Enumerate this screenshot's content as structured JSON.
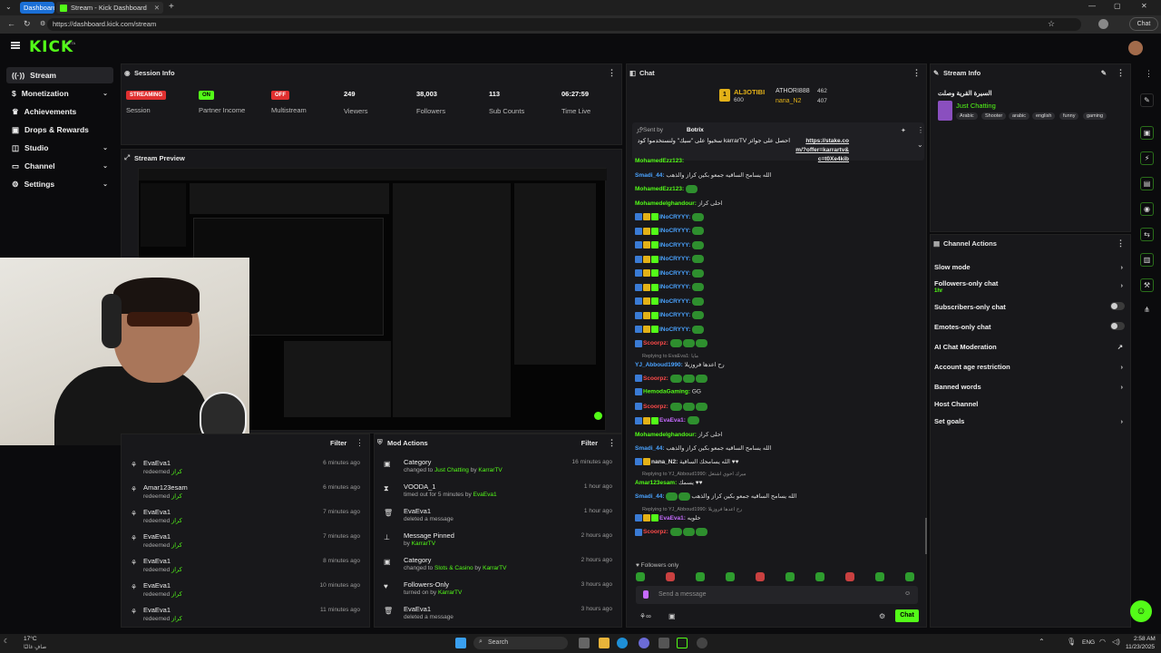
{
  "browser": {
    "tabs": [
      {
        "label": "Dashboard",
        "active": false
      },
      {
        "label": "Stream - Kick Dashboard",
        "active": true
      }
    ],
    "url": "https://dashboard.kick.com/stream",
    "chat_label": "Chat"
  },
  "brand": {
    "logo": "KICK",
    "beta": "BETA",
    "accent": "#53fc18"
  },
  "sidebar": {
    "items": [
      {
        "label": "Stream",
        "icon": "broadcast-icon",
        "active": true,
        "expandable": false
      },
      {
        "label": "Monetization",
        "icon": "dollar-icon",
        "active": false,
        "expandable": true
      },
      {
        "label": "Achievements",
        "icon": "trophy-icon",
        "active": false,
        "expandable": false
      },
      {
        "label": "Drops & Rewards",
        "icon": "gift-icon",
        "active": false,
        "expandable": false
      },
      {
        "label": "Studio",
        "icon": "studio-icon",
        "active": false,
        "expandable": true
      },
      {
        "label": "Channel",
        "icon": "channel-icon",
        "active": false,
        "expandable": true
      },
      {
        "label": "Settings",
        "icon": "gear-icon",
        "active": false,
        "expandable": true
      }
    ]
  },
  "session": {
    "title": "Session Info",
    "stats": [
      {
        "value": "STREAMING",
        "label": "Session",
        "kind": "badge-red"
      },
      {
        "value": "ON",
        "label": "Partner Income",
        "kind": "badge-green"
      },
      {
        "value": "OFF",
        "label": "Multistream",
        "kind": "badge-red"
      },
      {
        "value": "249",
        "label": "Viewers",
        "kind": "text"
      },
      {
        "value": "38,003",
        "label": "Followers",
        "kind": "text"
      },
      {
        "value": "113",
        "label": "Sub Counts",
        "kind": "text"
      },
      {
        "value": "06:27:59",
        "label": "Time Live",
        "kind": "text"
      }
    ]
  },
  "preview": {
    "title": "Stream Preview"
  },
  "activity": {
    "filter_label": "Filter",
    "items": [
      {
        "user": "EvaEva1",
        "action": "redeemed",
        "reward": "كراز",
        "time": "6 minutes ago"
      },
      {
        "user": "Amar123esam",
        "action": "redeemed",
        "reward": "كراز",
        "time": "6 minutes ago"
      },
      {
        "user": "EvaEva1",
        "action": "redeemed",
        "reward": "كراز",
        "time": "7 minutes ago"
      },
      {
        "user": "EvaEva1",
        "action": "redeemed",
        "reward": "كراز",
        "time": "7 minutes ago"
      },
      {
        "user": "EvaEva1",
        "action": "redeemed",
        "reward": "كراز",
        "time": "8 minutes ago"
      },
      {
        "user": "EvaEva1",
        "action": "redeemed",
        "reward": "كراز",
        "time": "10 minutes ago"
      },
      {
        "user": "EvaEva1",
        "action": "redeemed",
        "reward": "كراز",
        "time": "11 minutes ago"
      }
    ]
  },
  "mod_actions": {
    "title": "Mod Actions",
    "filter_label": "Filter",
    "items": [
      {
        "icon": "category-icon",
        "title": "Category",
        "pre": "changed to ",
        "hl1": "Just Chatting",
        "mid": " by ",
        "hl2": "KarrarTV",
        "time": "16 minutes ago"
      },
      {
        "icon": "hourglass-icon",
        "title": "VOODA_1",
        "pre": "timed out for 5 minutes by ",
        "hl1": "EvaEva1",
        "mid": "",
        "hl2": "",
        "time": "1 hour ago"
      },
      {
        "icon": "trash-icon",
        "title": "EvaEva1",
        "pre": "deleted a message",
        "hl1": "",
        "mid": "",
        "hl2": "",
        "time": "1 hour ago"
      },
      {
        "icon": "pin-icon",
        "title": "Message Pinned",
        "pre": "by ",
        "hl1": "KarrarTV",
        "mid": "",
        "hl2": "",
        "time": "2 hours ago"
      },
      {
        "icon": "category-icon",
        "title": "Category",
        "pre": "changed to ",
        "hl1": "Slots & Casino",
        "mid": " by ",
        "hl2": "KarrarTV",
        "time": "2 hours ago"
      },
      {
        "icon": "heart-icon",
        "title": "Followers-Only",
        "pre": "turned on by ",
        "hl1": "KarrarTV",
        "mid": "",
        "hl2": "",
        "time": "3 hours ago"
      },
      {
        "icon": "trash-icon",
        "title": "EvaEva1",
        "pre": "deleted a message",
        "hl1": "",
        "mid": "",
        "hl2": "",
        "time": "3 hours ago"
      }
    ]
  },
  "chat": {
    "title": "Chat",
    "leaders": [
      {
        "rank": "1",
        "name": "AL3OTIBI",
        "score": "600"
      },
      {
        "rank": "",
        "name": "ATHORI888",
        "score": "462"
      },
      {
        "rank": "",
        "name": "nana_N2",
        "score": "407"
      }
    ],
    "pinned": {
      "sent_by_label": "Sent by",
      "sender": "Botrix",
      "text": "احصل على جوائز karrarTV سخيوا على \"سيك\" ولنستخدموا كود",
      "link": "https://stake.com/?offer=karrartv&c=t0Xe4kib"
    },
    "messages": [
      {
        "user": "MohamedEzz123:",
        "color": "#53fc18",
        "text": "",
        "emotes": 0,
        "badges": 0,
        "reply": ""
      },
      {
        "user": "Smadi_44:",
        "color": "#4aa3ff",
        "text": "الله يسامح الساقيه جمعو بكين كراز والذهب",
        "emotes": 0,
        "badges": 0,
        "reply": ""
      },
      {
        "user": "MohamedEzz123:",
        "color": "#53fc18",
        "text": "",
        "emotes": 1,
        "badges": 0,
        "reply": ""
      },
      {
        "user": "Mohamedelghandour:",
        "color": "#53fc18",
        "text": "احلى كراز",
        "emotes": 0,
        "badges": 0,
        "reply": ""
      },
      {
        "user": "INoCRYYY:",
        "color": "#4aa3ff",
        "text": "",
        "emotes": 1,
        "badges": 3,
        "reply": ""
      },
      {
        "user": "INoCRYYY:",
        "color": "#4aa3ff",
        "text": "",
        "emotes": 1,
        "badges": 3,
        "reply": ""
      },
      {
        "user": "INoCRYYY:",
        "color": "#4aa3ff",
        "text": "",
        "emotes": 1,
        "badges": 3,
        "reply": ""
      },
      {
        "user": "INoCRYYY:",
        "color": "#4aa3ff",
        "text": "",
        "emotes": 1,
        "badges": 3,
        "reply": ""
      },
      {
        "user": "INoCRYYY:",
        "color": "#4aa3ff",
        "text": "",
        "emotes": 1,
        "badges": 3,
        "reply": ""
      },
      {
        "user": "INoCRYYY:",
        "color": "#4aa3ff",
        "text": "",
        "emotes": 1,
        "badges": 3,
        "reply": ""
      },
      {
        "user": "INoCRYYY:",
        "color": "#4aa3ff",
        "text": "",
        "emotes": 1,
        "badges": 3,
        "reply": ""
      },
      {
        "user": "INoCRYYY:",
        "color": "#4aa3ff",
        "text": "",
        "emotes": 1,
        "badges": 3,
        "reply": ""
      },
      {
        "user": "INoCRYYY:",
        "color": "#4aa3ff",
        "text": "",
        "emotes": 1,
        "badges": 3,
        "reply": ""
      },
      {
        "user": "Scoorpz:",
        "color": "#ff4a4a",
        "text": "",
        "emotes": 3,
        "badges": 1,
        "reply": ""
      },
      {
        "user": "YJ_Abboud1990:",
        "color": "#4aa3ff",
        "text": "رح اعدها فروزيلا",
        "emotes": 0,
        "badges": 0,
        "reply": "Replying to EvaEva1: مايا"
      },
      {
        "user": "Scoorpz:",
        "color": "#ff4a4a",
        "text": "",
        "emotes": 3,
        "badges": 1,
        "reply": ""
      },
      {
        "user": "HemodaGaming:",
        "color": "#53fc18",
        "text": "GG",
        "emotes": 0,
        "badges": 1,
        "reply": ""
      },
      {
        "user": "Scoorpz:",
        "color": "#ff4a4a",
        "text": "",
        "emotes": 3,
        "badges": 1,
        "reply": ""
      },
      {
        "user": "EvaEva1:",
        "color": "#c66bff",
        "text": "",
        "emotes": 1,
        "badges": 3,
        "reply": ""
      },
      {
        "user": "Mohamedelghandour:",
        "color": "#53fc18",
        "text": "احلى كراز",
        "emotes": 0,
        "badges": 0,
        "reply": ""
      },
      {
        "user": "Smadi_44:",
        "color": "#4aa3ff",
        "text": "الله يسامح الساقيه جمعو بكين كراز والذهب",
        "emotes": 0,
        "badges": 0,
        "reply": ""
      },
      {
        "user": "nana_N2:",
        "color": "#e2e2e2",
        "text": "الله يسامحك الساقية ♥♥",
        "emotes": 0,
        "badges": 2,
        "reply": ""
      },
      {
        "user": "Amar123esam:",
        "color": "#53fc18",
        "text": "يسمك ♥♥",
        "emotes": 0,
        "badges": 0,
        "reply": "Replying to YJ_Abboud1990: ميرك اخوي اشتغل"
      },
      {
        "user": "Smadi_44:",
        "color": "#4aa3ff",
        "text": "الله يسامح الساقيه جمعو بكين كراز والذهب",
        "emotes": 2,
        "badges": 0,
        "reply": ""
      },
      {
        "user": "EvaEva1:",
        "color": "#c66bff",
        "text": "حلويه",
        "emotes": 0,
        "badges": 3,
        "reply": "Replying to YJ_Abboud1990: رح اعدها فروزيلا"
      },
      {
        "user": "Scoorpz:",
        "color": "#ff4a4a",
        "text": "",
        "emotes": 3,
        "badges": 1,
        "reply": ""
      }
    ],
    "mode_label": "Followers only",
    "input_placeholder": "Send a message",
    "send_label": "Chat"
  },
  "stream_info": {
    "title": "Stream Info",
    "stream_title": "السيرة القرية وصلت",
    "category": "Just Chatting",
    "tags": [
      "Arabic",
      "Shooter",
      "arabic",
      "english",
      "funny",
      "gaming"
    ]
  },
  "channel_actions": {
    "title": "Channel Actions",
    "items": [
      {
        "label": "Slow mode",
        "sub": "",
        "control": "chevron"
      },
      {
        "label": "Followers-only chat",
        "sub": "1hr",
        "control": "chevron"
      },
      {
        "label": "Subscribers-only chat",
        "sub": "",
        "control": "toggle"
      },
      {
        "label": "Emotes-only chat",
        "sub": "",
        "control": "toggle"
      },
      {
        "label": "AI Chat Moderation",
        "sub": "",
        "control": "external"
      },
      {
        "label": "Account age restriction",
        "sub": "",
        "control": "chevron"
      },
      {
        "label": "Banned words",
        "sub": "",
        "control": "chevron"
      },
      {
        "label": "Host Channel",
        "sub": "",
        "control": "none"
      },
      {
        "label": "Set goals",
        "sub": "",
        "control": "chevron"
      }
    ]
  },
  "taskbar": {
    "weather_temp": "17°C",
    "weather_desc": "صافٍ غالبًا",
    "search_label": "Search",
    "lang": "ENG",
    "time": "2:58 AM",
    "date": "11/23/2025"
  }
}
